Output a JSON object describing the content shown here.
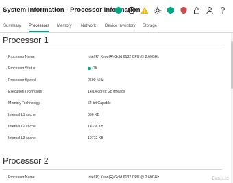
{
  "header": {
    "title": "System Information - Processor Information",
    "icons": [
      "health-ok-icon",
      "globe-icon",
      "warning-icon",
      "sun-icon",
      "hexagon-icon",
      "shield-icon",
      "lock-icon",
      "user-icon",
      "help-icon"
    ]
  },
  "tabs": [
    {
      "label": "Summary",
      "active": false
    },
    {
      "label": "Processors",
      "active": true
    },
    {
      "label": "Memory",
      "active": false
    },
    {
      "label": "Network",
      "active": false
    },
    {
      "label": "Device Inventory",
      "active": false
    },
    {
      "label": "Storage",
      "active": false
    }
  ],
  "processor1": {
    "title": "Processor 1",
    "rows": [
      {
        "label": "Processor Name",
        "value": "Intel(R) Xeon(R) Gold 6132 CPU @ 2.60GHz"
      },
      {
        "label": "Processor Status",
        "value": "OK"
      },
      {
        "label": "Processor Speed",
        "value": "2600 MHz"
      },
      {
        "label": "Execution Technology",
        "value": "14/14 cores; 28 threads"
      },
      {
        "label": "Memory Technology",
        "value": "64-bit Capable"
      },
      {
        "label": "Internal L1 cache",
        "value": "896 KB"
      },
      {
        "label": "Internal L2 cache",
        "value": "14336 KB"
      },
      {
        "label": "Internal L3 cache",
        "value": "19712 KB"
      }
    ]
  },
  "processor2": {
    "title": "Processor 2",
    "rows": [
      {
        "label": "Processor Name",
        "value": "Intel(R) Xeon(R) Gold 6132 CPU @ 2.60GHz"
      }
    ]
  },
  "watermark": "Bazos.cz",
  "colors": {
    "accent": "#01a982",
    "warning": "#f2b705",
    "danger": "#c54e4b"
  }
}
